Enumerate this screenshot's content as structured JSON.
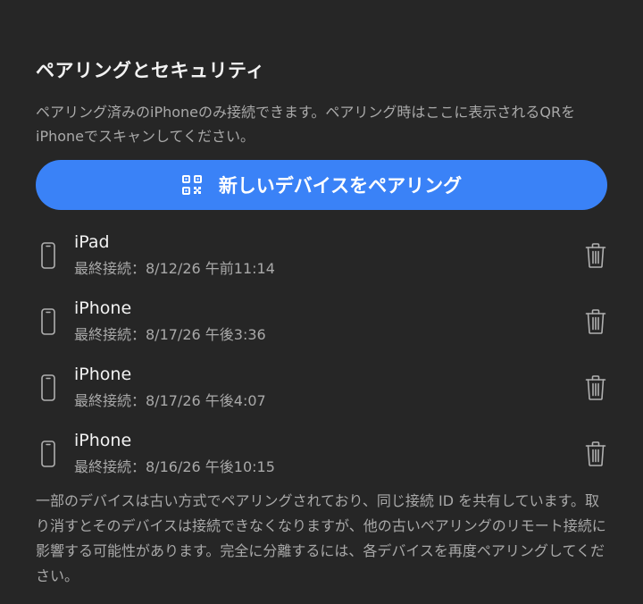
{
  "section": {
    "title": "ペアリングとセキュリティ",
    "description": "ペアリング済みのiPhoneのみ接続できます。ペアリング時はここに表示されるQRをiPhoneでスキャンしてください。"
  },
  "pair_button": {
    "label": "新しいデバイスをペアリング",
    "icon": "qr-code-icon",
    "color": "#3a82f7"
  },
  "devices": [
    {
      "name": "iPad",
      "last_connected": "最終接続：8/12/26 午前11:14",
      "icon": "phone-icon"
    },
    {
      "name": "iPhone",
      "last_connected": "最終接続：8/17/26 午後3:36",
      "icon": "phone-icon"
    },
    {
      "name": "iPhone",
      "last_connected": "最終接続：8/17/26 午後4:07",
      "icon": "phone-icon"
    },
    {
      "name": "iPhone",
      "last_connected": "最終接続：8/16/26 午後10:15",
      "icon": "phone-icon"
    }
  ],
  "note": "一部のデバイスは古い方式でペアリングされており、同じ接続 ID を共有しています。取り消すとそのデバイスは接続できなくなりますが、他の古いペアリングのリモート接続に影響する可能性があります。完全に分離するには、各デバイスを再度ペアリングしてください。"
}
